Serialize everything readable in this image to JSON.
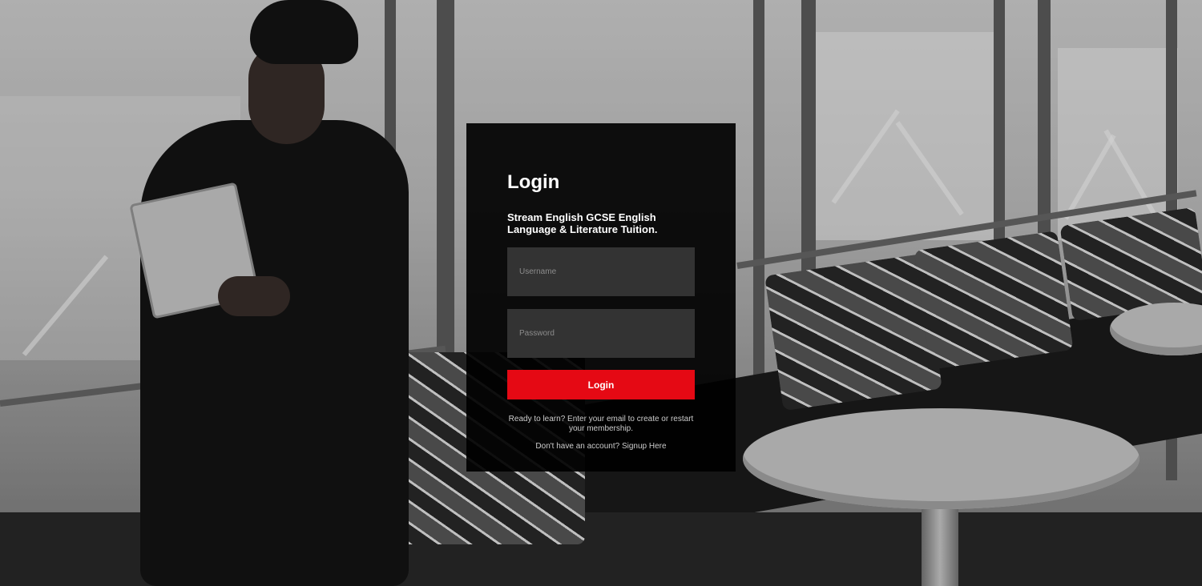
{
  "login": {
    "title": "Login",
    "subtitle": "Stream English GCSE English Language & Literature Tuition.",
    "username_placeholder": "Username",
    "password_placeholder": "Password",
    "button_label": "Login",
    "helper_text": "Ready to learn? Enter your email to create or restart your membership.",
    "signup_prefix": "Don't have an account?",
    "signup_link": "Signup Here"
  },
  "colors": {
    "card_background": "#000000",
    "field_background": "#333333",
    "accent": "#e50914"
  }
}
